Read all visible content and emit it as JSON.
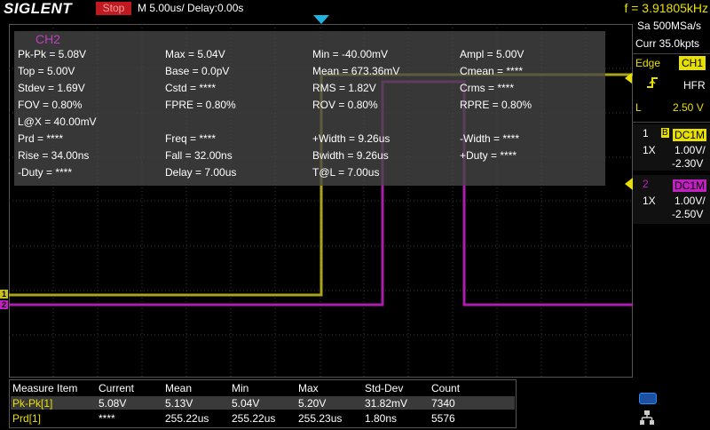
{
  "topbar": {
    "logo": "SIGLENT",
    "run_state": "Stop",
    "timebase": "M 5.00us/  Delay:0.00s",
    "frequency": "f = 3.91805kHz"
  },
  "measure_panel": {
    "title": "CH2",
    "items": [
      [
        "Pk-Pk = 5.08V",
        "Max = 5.04V",
        "Min = -40.00mV",
        "Ampl = 5.00V"
      ],
      [
        "Top = 5.00V",
        "Base = 0.0pV",
        "Mean = 673.36mV",
        "Cmean = ****"
      ],
      [
        "Stdev = 1.69V",
        "Cstd = ****",
        "RMS = 1.82V",
        "Crms = ****"
      ],
      [
        "FOV = 0.80%",
        "FPRE = 0.80%",
        "ROV = 0.80%",
        "RPRE = 0.80%"
      ],
      [
        "L@X = 40.00mV",
        "",
        "",
        ""
      ],
      [
        "Prd = ****",
        "Freq = ****",
        "+Width = 9.26us",
        "-Width = ****"
      ],
      [
        "Rise = 34.00ns",
        "Fall = 32.00ns",
        "Bwidth = 9.26us",
        "+Duty = ****"
      ],
      [
        "-Duty = ****",
        "Delay = 7.00us",
        "T@L = 7.00us",
        ""
      ]
    ]
  },
  "right_panel": {
    "sample_rate": "Sa 500MSa/s",
    "record": "Curr 35.0kpts",
    "trigger_mode": "Edge",
    "trigger_source": "CH1",
    "trigger_coupling": "HFR",
    "trigger_level_label": "L",
    "trigger_level": "2.50 V",
    "ch1": {
      "num": "1",
      "bw": "B",
      "coupling": "DC1M",
      "probe": "1X",
      "scale": "1.00V/",
      "offset": "-2.30V"
    },
    "ch2": {
      "num": "2",
      "coupling": "DC1M",
      "probe": "1X",
      "scale": "1.00V/",
      "offset": "-2.50V"
    }
  },
  "stats_table": {
    "headers": [
      "Measure Item",
      "Current",
      "Mean",
      "Min",
      "Max",
      "Std-Dev",
      "Count"
    ],
    "rows": [
      [
        "Pk-Pk[1]",
        "5.08V",
        "5.13V",
        "5.04V",
        "5.20V",
        "31.82mV",
        "7340"
      ],
      [
        "Prd[1]",
        "****",
        "255.22us",
        "255.22us",
        "255.23us",
        "1.80ns",
        "5576"
      ]
    ]
  },
  "colors": {
    "ch1": "#c8c020",
    "ch2": "#c020c0",
    "trigger_marker": "#1fb4e0",
    "stop": "#c0191f"
  },
  "channel_markers": {
    "ch1": "1",
    "ch2": "2"
  }
}
